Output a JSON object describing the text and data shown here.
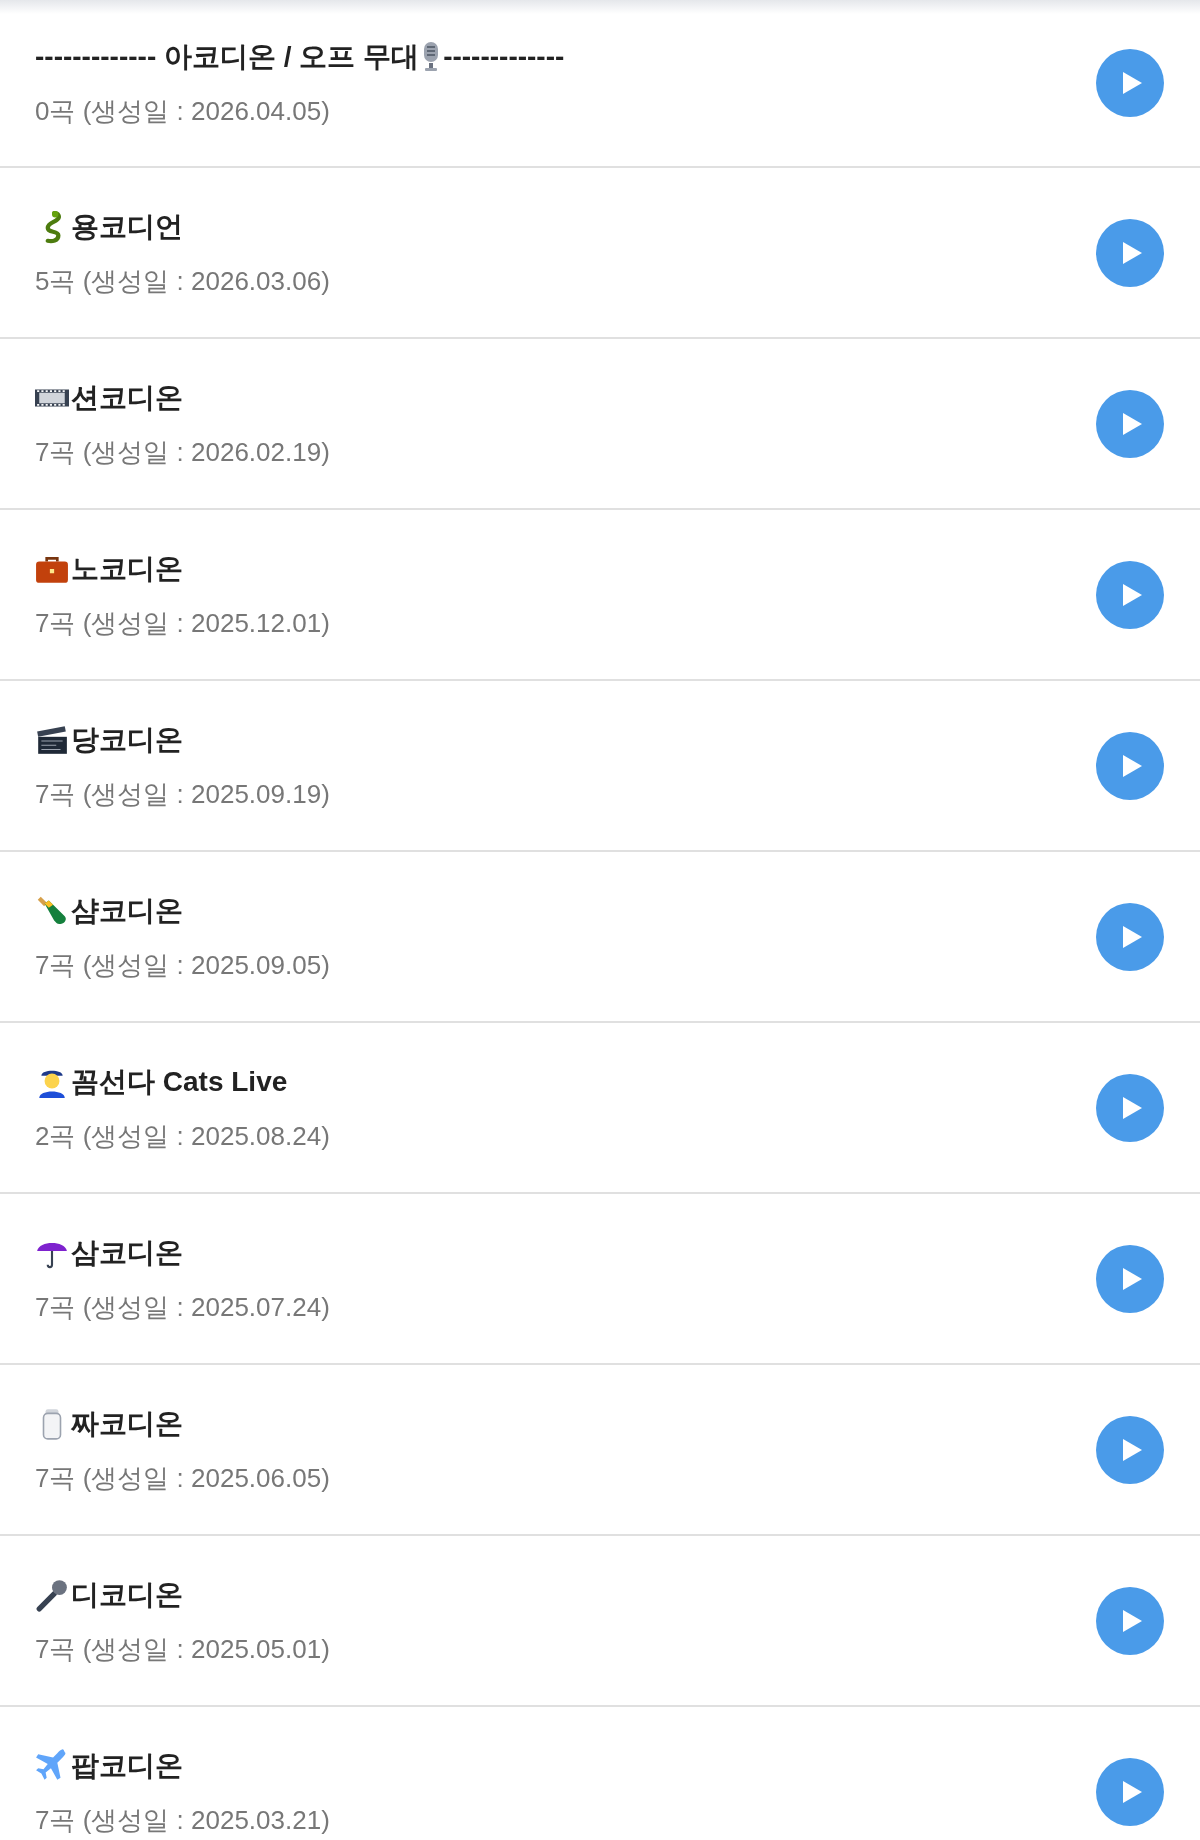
{
  "playlists": [
    {
      "kind": "studio-mic",
      "title": "------------- 아코디온 / 오프 무대",
      "title_after": "-------------",
      "subtitle": "0곡 (생성일 : 2026.04.05)"
    },
    {
      "kind": "dragon",
      "title": "용코디언",
      "subtitle": "5곡 (생성일 : 2026.03.06)"
    },
    {
      "kind": "film",
      "title": "션코디온",
      "subtitle": "7곡 (생성일 : 2026.02.19)"
    },
    {
      "kind": "briefcase",
      "title": "노코디온",
      "subtitle": "7곡 (생성일 : 2025.12.01)"
    },
    {
      "kind": "clapper",
      "title": "당코디온",
      "subtitle": "7곡 (생성일 : 2025.09.19)"
    },
    {
      "kind": "bottle",
      "title": "샴코디온",
      "subtitle": "7곡 (생성일 : 2025.09.05)"
    },
    {
      "kind": "officer",
      "title": "꼼선다 Cats Live",
      "subtitle": "2곡 (생성일 : 2025.08.24)"
    },
    {
      "kind": "umbrella",
      "title": "삼코디온",
      "subtitle": "7곡 (생성일 : 2025.07.24)"
    },
    {
      "kind": "jar",
      "title": "짜코디온",
      "subtitle": "7곡 (생성일 : 2025.06.05)"
    },
    {
      "kind": "microphone",
      "title": "디코디온",
      "subtitle": "7곡 (생성일 : 2025.05.01)"
    },
    {
      "kind": "airplane",
      "title": "팝코디온",
      "subtitle": "7곡 (생성일 : 2025.03.21)"
    }
  ]
}
